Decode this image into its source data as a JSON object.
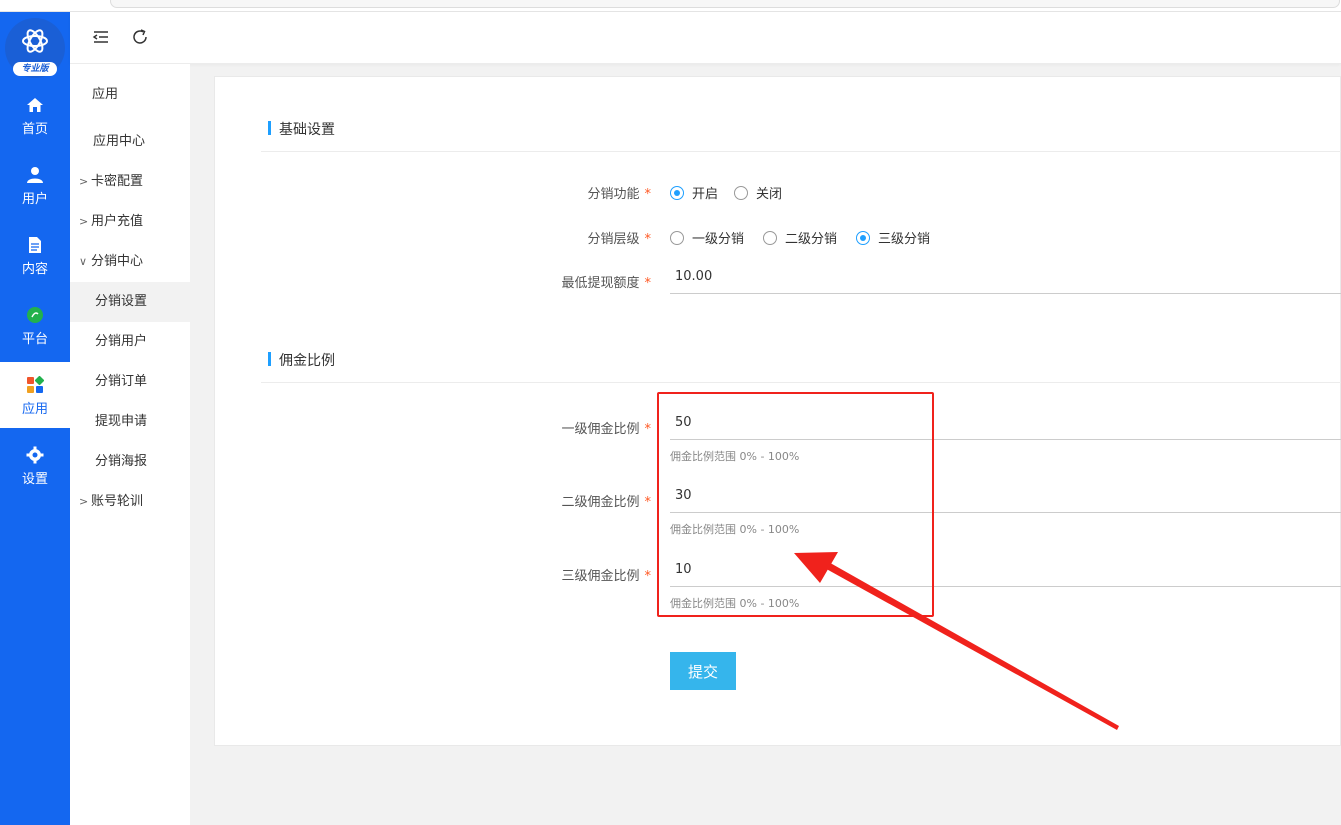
{
  "app": {
    "logo_badge": "专业版",
    "accent": "#1467f0",
    "theme_blue": "#1e9fff"
  },
  "rail": [
    {
      "label": "首页",
      "icon": "home-icon"
    },
    {
      "label": "用户",
      "icon": "user-icon"
    },
    {
      "label": "内容",
      "icon": "document-icon"
    },
    {
      "label": "平台",
      "icon": "platform-icon"
    },
    {
      "label": "应用",
      "icon": "apps-icon",
      "active": true
    },
    {
      "label": "设置",
      "icon": "gear-icon"
    }
  ],
  "subnav": {
    "title": "应用",
    "items": [
      {
        "label": "应用中心"
      },
      {
        "label": "卡密配置"
      },
      {
        "label": "用户充值"
      },
      {
        "label": "分销中心"
      },
      {
        "label": "分销设置"
      },
      {
        "label": "分销用户"
      },
      {
        "label": "分销订单"
      },
      {
        "label": "提现申请"
      },
      {
        "label": "分销海报"
      },
      {
        "label": "账号轮训"
      }
    ]
  },
  "basic": {
    "title": "基础设置",
    "distribution_label": "分销功能",
    "distribution_options": [
      "开启",
      "关闭"
    ],
    "level_label": "分销层级",
    "level_options": [
      "一级分销",
      "二级分销",
      "三级分销"
    ],
    "min_withdraw_label": "最低提现额度",
    "min_withdraw_value": "10.00"
  },
  "commission": {
    "title": "佣金比例",
    "level1_label": "一级佣金比例",
    "level1_value": "50",
    "level2_label": "二级佣金比例",
    "level2_value": "30",
    "level3_label": "三级佣金比例",
    "level3_value": "10",
    "hint": "佣金比例范围 0% - 100%"
  },
  "submit_label": "提交",
  "required_mark": "*"
}
